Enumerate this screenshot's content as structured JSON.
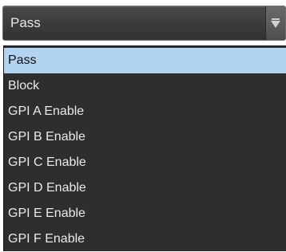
{
  "dropdown": {
    "selected_value": "Pass",
    "arrow_icon": "triangle-down-icon",
    "options": [
      {
        "label": "Pass",
        "selected": true
      },
      {
        "label": "Block",
        "selected": false
      },
      {
        "label": "GPI A Enable",
        "selected": false
      },
      {
        "label": "GPI B Enable",
        "selected": false
      },
      {
        "label": "GPI C Enable",
        "selected": false
      },
      {
        "label": "GPI D Enable",
        "selected": false
      },
      {
        "label": "GPI E Enable",
        "selected": false
      },
      {
        "label": "GPI F Enable",
        "selected": false
      }
    ]
  },
  "colors": {
    "highlight": "#b3d4f1",
    "list_background": "#2e2e2e",
    "combo_background": "#3a3a3a"
  }
}
